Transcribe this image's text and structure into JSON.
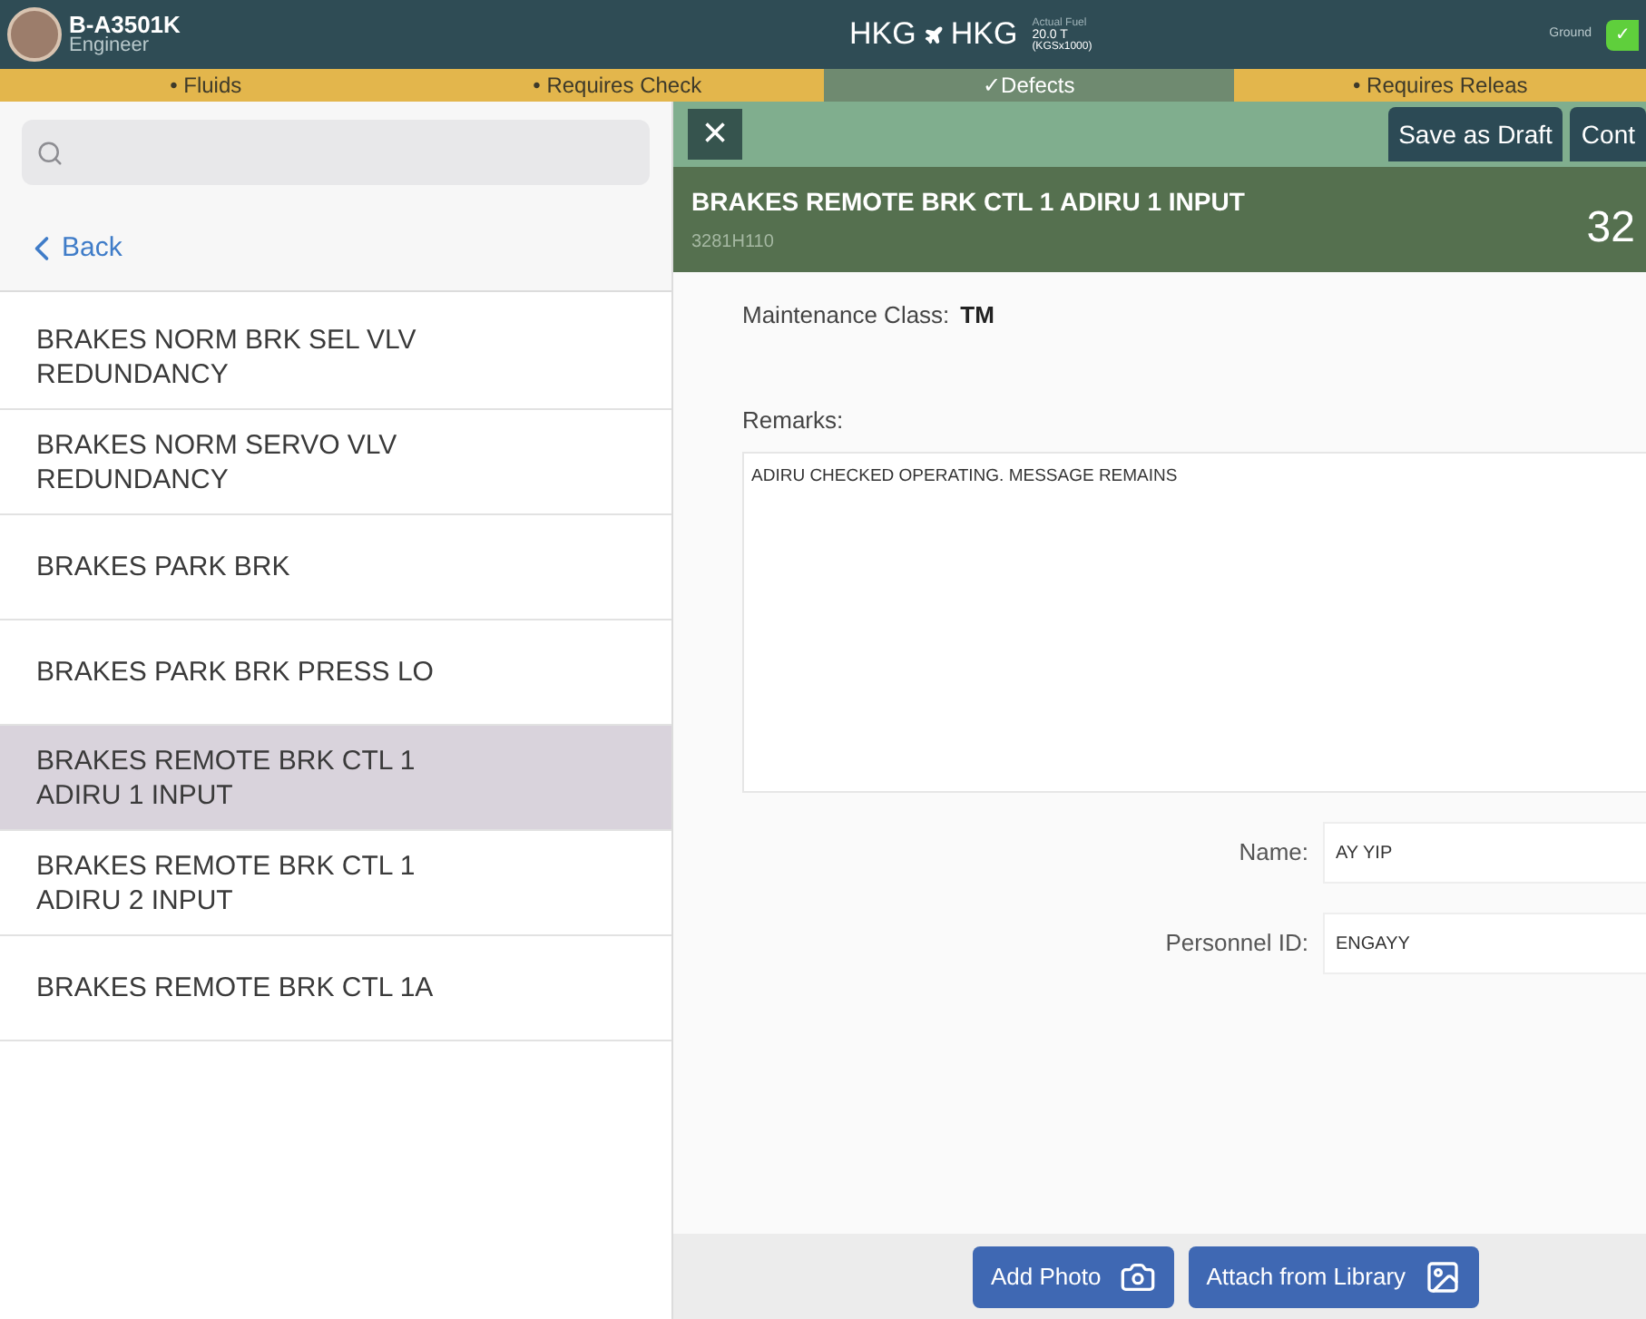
{
  "header": {
    "registration": "B-A3501K",
    "role": "Engineer",
    "origin": "HKG",
    "destination": "HKG",
    "fuel_label": "Actual Fuel",
    "fuel_value": "20.0 T",
    "fuel_unit": "(KGSx1000)",
    "status_label": "Ground",
    "status_mark": "✓"
  },
  "tabs": [
    {
      "label": "• Fluids",
      "selected": false
    },
    {
      "label": "• Requires Check",
      "selected": false
    },
    {
      "label": "✓Defects",
      "selected": true
    },
    {
      "label": "• Requires Releas",
      "selected": false
    }
  ],
  "sidebar": {
    "back": "Back",
    "items": [
      {
        "label": "BRAKES NORM BRK SEL VLV REDUNDANCY",
        "selected": false
      },
      {
        "label": "BRAKES NORM SERVO VLV REDUNDANCY",
        "selected": false
      },
      {
        "label": "BRAKES PARK BRK",
        "selected": false
      },
      {
        "label": "BRAKES PARK BRK PRESS LO",
        "selected": false
      },
      {
        "label": "BRAKES REMOTE BRK CTL 1 ADIRU 1 INPUT",
        "selected": true
      },
      {
        "label": "BRAKES REMOTE BRK CTL 1 ADIRU 2 INPUT",
        "selected": false
      },
      {
        "label": "BRAKES REMOTE BRK CTL 1A",
        "selected": false
      }
    ]
  },
  "toolbar": {
    "close": "×",
    "buttons": [
      "Save as Draft",
      "Cont"
    ]
  },
  "defect": {
    "title": "BRAKES REMOTE BRK CTL 1 ADIRU 1 INPUT",
    "code": "3281H110",
    "number": "32"
  },
  "form": {
    "class_label": "Maintenance Class:",
    "class_value": "TM",
    "remarks_label": "Remarks:",
    "remarks": "ADIRU CHECKED OPERATING. MESSAGE REMAINS",
    "fields": [
      {
        "label": "Name:",
        "value": "AY YIP"
      },
      {
        "label": "Personnel ID:",
        "value": "ENGAYY"
      }
    ]
  },
  "actions": [
    "Add Photo",
    "Attach from Library"
  ]
}
